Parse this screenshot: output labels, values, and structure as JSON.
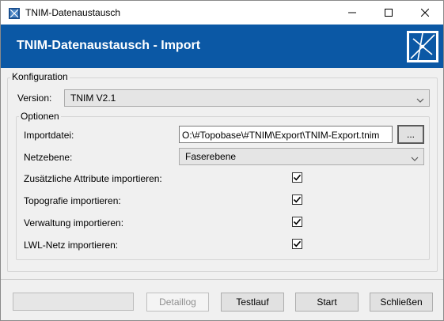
{
  "window": {
    "title": "TNIM-Datenaustausch",
    "header_title": "TNIM-Datenaustausch - Import"
  },
  "konfiguration": {
    "legend": "Konfiguration",
    "version_label": "Version:",
    "version_value": "TNIM V2.1"
  },
  "optionen": {
    "legend": "Optionen",
    "importdatei_label": "Importdatei:",
    "importdatei_value": "O:\\#Topobase\\#TNIM\\Export\\TNIM-Export.tnim",
    "browse_label": "...",
    "netzebene_label": "Netzebene:",
    "netzebene_value": "Faserebene",
    "options": [
      {
        "label": "Zusätzliche Attribute importieren:",
        "checked": true
      },
      {
        "label": "Topografie importieren:",
        "checked": true
      },
      {
        "label": "Verwaltung importieren:",
        "checked": true
      },
      {
        "label": "LWL-Netz importieren:",
        "checked": true
      }
    ]
  },
  "footer": {
    "progress": 0,
    "detaillog_label": "Detaillog",
    "testlauf_label": "Testlauf",
    "start_label": "Start",
    "schliessen_label": "Schließen"
  },
  "colors": {
    "header_bg": "#0b58a5",
    "header_text": "#ffffff"
  },
  "icons": {
    "app": "tnim-app-icon",
    "logo": "tnim-logo-icon",
    "minimize": "minimize-icon",
    "maximize": "maximize-icon",
    "close": "close-icon",
    "dropdown": "chevron-down-icon",
    "check": "checkmark-icon"
  }
}
